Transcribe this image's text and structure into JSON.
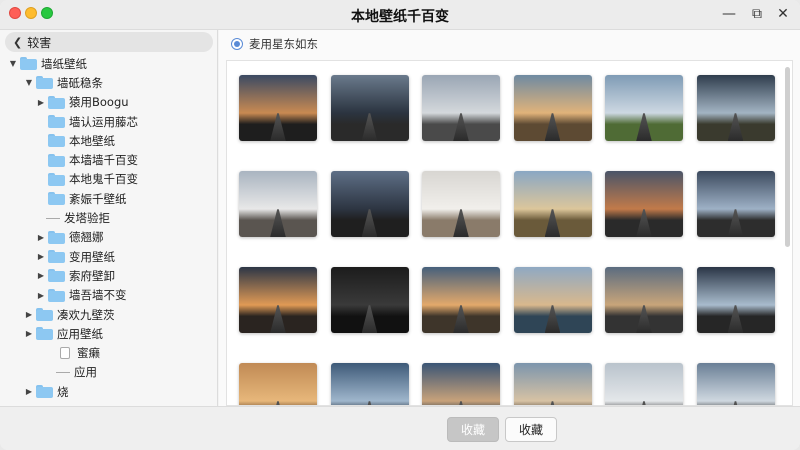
{
  "window": {
    "title": "本地壁纸千百变"
  },
  "sidebar": {
    "back_label": "较害",
    "tree": [
      {
        "label": "墙纸壁纸",
        "level": 1,
        "caret": "▼",
        "kind": "folder"
      },
      {
        "label": "墙砥稳条",
        "level": 2,
        "caret": "▼",
        "kind": "folder"
      },
      {
        "label": "猿用Boogu",
        "level": 3,
        "caret": "▶",
        "kind": "folder"
      },
      {
        "label": "墙认运用藤芯",
        "level": 3,
        "caret": "",
        "kind": "folder"
      },
      {
        "label": "本地壁纸",
        "level": 3,
        "caret": "",
        "kind": "folder"
      },
      {
        "label": "本墙墙千百变",
        "level": 3,
        "caret": "",
        "kind": "folder"
      },
      {
        "label": "本地鬼千百变",
        "level": 3,
        "caret": "",
        "kind": "folder"
      },
      {
        "label": "紊娠千壁纸",
        "level": 3,
        "caret": "",
        "kind": "folder"
      },
      {
        "label": "发塔验拒",
        "level": 3,
        "caret": "",
        "kind": "dash"
      },
      {
        "label": "德翘娜",
        "level": 3,
        "caret": "▶",
        "kind": "folder"
      },
      {
        "label": "变用壁纸",
        "level": 3,
        "caret": "▶",
        "kind": "folder"
      },
      {
        "label": "索府壁卸",
        "level": 3,
        "caret": "▶",
        "kind": "folder"
      },
      {
        "label": "墙吾墙不变",
        "level": 3,
        "caret": "▶",
        "kind": "folder"
      },
      {
        "label": "凑欢九壁茨",
        "level": 2,
        "caret": "▶",
        "kind": "folder"
      },
      {
        "label": "应用壁纸",
        "level": 2,
        "caret": "▶",
        "kind": "folder"
      },
      {
        "label": "蜜癞",
        "level": 4,
        "caret": "",
        "kind": "doc"
      },
      {
        "label": "应用",
        "level": 4,
        "caret": "",
        "kind": "dash"
      },
      {
        "label": "烧",
        "level": 2,
        "caret": "▶",
        "kind": "folder"
      }
    ]
  },
  "content": {
    "radio_label": "麦用星东如东",
    "thumbnails": [
      {
        "sky": "#3b4a63",
        "sky2": "#c98a52",
        "ground": "#1e1e1e"
      },
      {
        "sky": "#6a7a8c",
        "sky2": "#2b3440",
        "ground": "#2a2a2a"
      },
      {
        "sky": "#9aa6b4",
        "sky2": "#d4d8dc",
        "ground": "#4a4a4a"
      },
      {
        "sky": "#6f8aa2",
        "sky2": "#e1b37a",
        "ground": "#5d4a33"
      },
      {
        "sky": "#7f9bb5",
        "sky2": "#cdd8e2",
        "ground": "#4f6b35"
      },
      {
        "sky": "#2f3d4d",
        "sky2": "#a3b4c3",
        "ground": "#3a3a2e"
      },
      {
        "sky": "#a9b4c0",
        "sky2": "#e8e8e8",
        "ground": "#5a5550"
      },
      {
        "sky": "#5e6f86",
        "sky2": "#2d3542",
        "ground": "#1f1f1f"
      },
      {
        "sky": "#d8d6d2",
        "sky2": "#f1efeb",
        "ground": "#8a7b6a"
      },
      {
        "sky": "#8aa7c4",
        "sky2": "#dcc69b",
        "ground": "#6a5a3a"
      },
      {
        "sky": "#4a5468",
        "sky2": "#c27a4a",
        "ground": "#2a2a2a"
      },
      {
        "sky": "#3c4a5e",
        "sky2": "#9eb1c6",
        "ground": "#2d2d2d"
      },
      {
        "sky": "#2c3646",
        "sky2": "#e09a55",
        "ground": "#2a2420"
      },
      {
        "sky": "#1c1c1c",
        "sky2": "#3a3a3a",
        "ground": "#111111"
      },
      {
        "sky": "#46607c",
        "sky2": "#e3a96b",
        "ground": "#3e352a"
      },
      {
        "sky": "#8fa9c3",
        "sky2": "#d9b88d",
        "ground": "#2f4556"
      },
      {
        "sky": "#5b6c80",
        "sky2": "#c9a57a",
        "ground": "#333333"
      },
      {
        "sky": "#2a3546",
        "sky2": "#a9bccd",
        "ground": "#262626"
      },
      {
        "sky": "#c08a55",
        "sky2": "#e7b77a",
        "ground": "#5a3a20"
      },
      {
        "sky": "#3e5a78",
        "sky2": "#9fb6cc",
        "ground": "#1f2a36"
      },
      {
        "sky": "#3a5575",
        "sky2": "#c8a27a",
        "ground": "#2c3b4b"
      },
      {
        "sky": "#7c95ad",
        "sky2": "#d7c2a4",
        "ground": "#4a3f33"
      },
      {
        "sky": "#b9c3cc",
        "sky2": "#e4e7ea",
        "ground": "#3a3a3a"
      },
      {
        "sky": "#6a7f96",
        "sky2": "#cfd8e0",
        "ground": "#2e2e2e"
      }
    ]
  },
  "footer": {
    "primary_label": "收藏",
    "secondary_label": "收藏"
  },
  "colors": {
    "accent": "#5a8bd6",
    "folder": "#8dc8f2"
  }
}
